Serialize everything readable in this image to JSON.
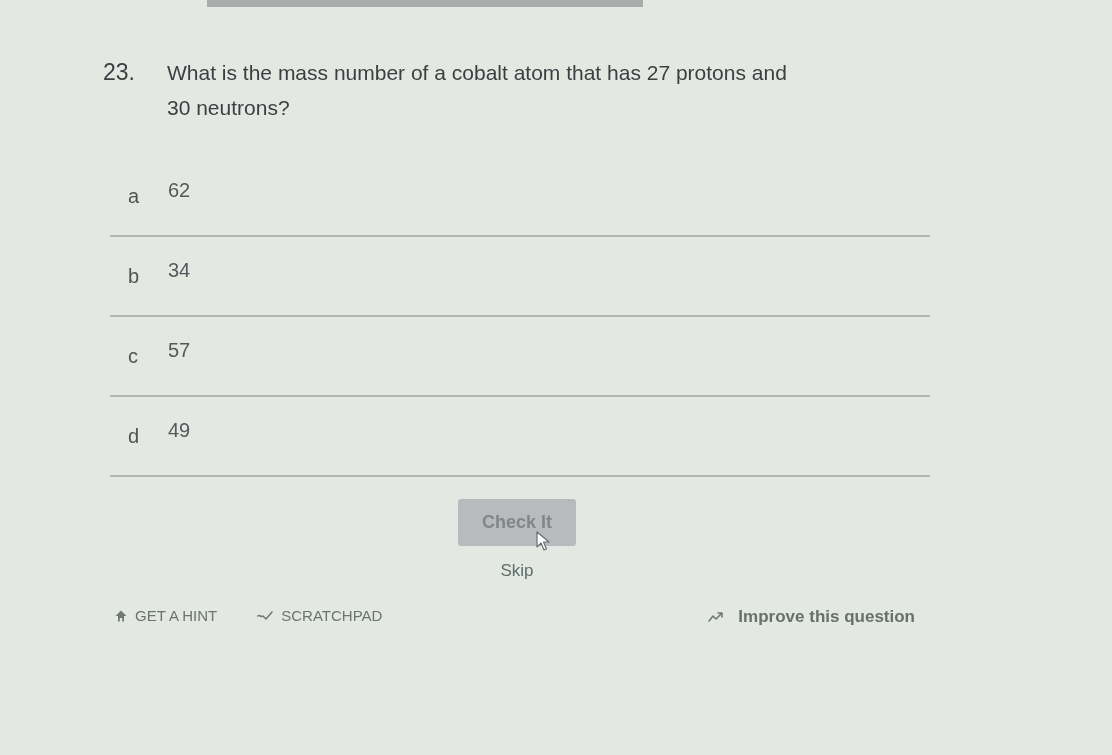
{
  "question": {
    "number": "23.",
    "text": "What is the mass number of a cobalt atom that has 27 protons and 30 neutrons?"
  },
  "options": [
    {
      "letter": "a",
      "value": "62",
      "selected": false
    },
    {
      "letter": "b",
      "value": "34",
      "selected": false
    },
    {
      "letter": "c",
      "value": "57",
      "selected": false
    },
    {
      "letter": "d",
      "value": "49",
      "selected": false
    }
  ],
  "check_button": {
    "label": "Check It",
    "disabled": true
  },
  "skip": {
    "label": "Skip"
  },
  "tools": [
    {
      "kind": "hint",
      "label": "GET A HINT"
    },
    {
      "kind": "scratchpad",
      "label": "SCRATCHPAD"
    }
  ],
  "improve": {
    "label": "Improve this question"
  }
}
